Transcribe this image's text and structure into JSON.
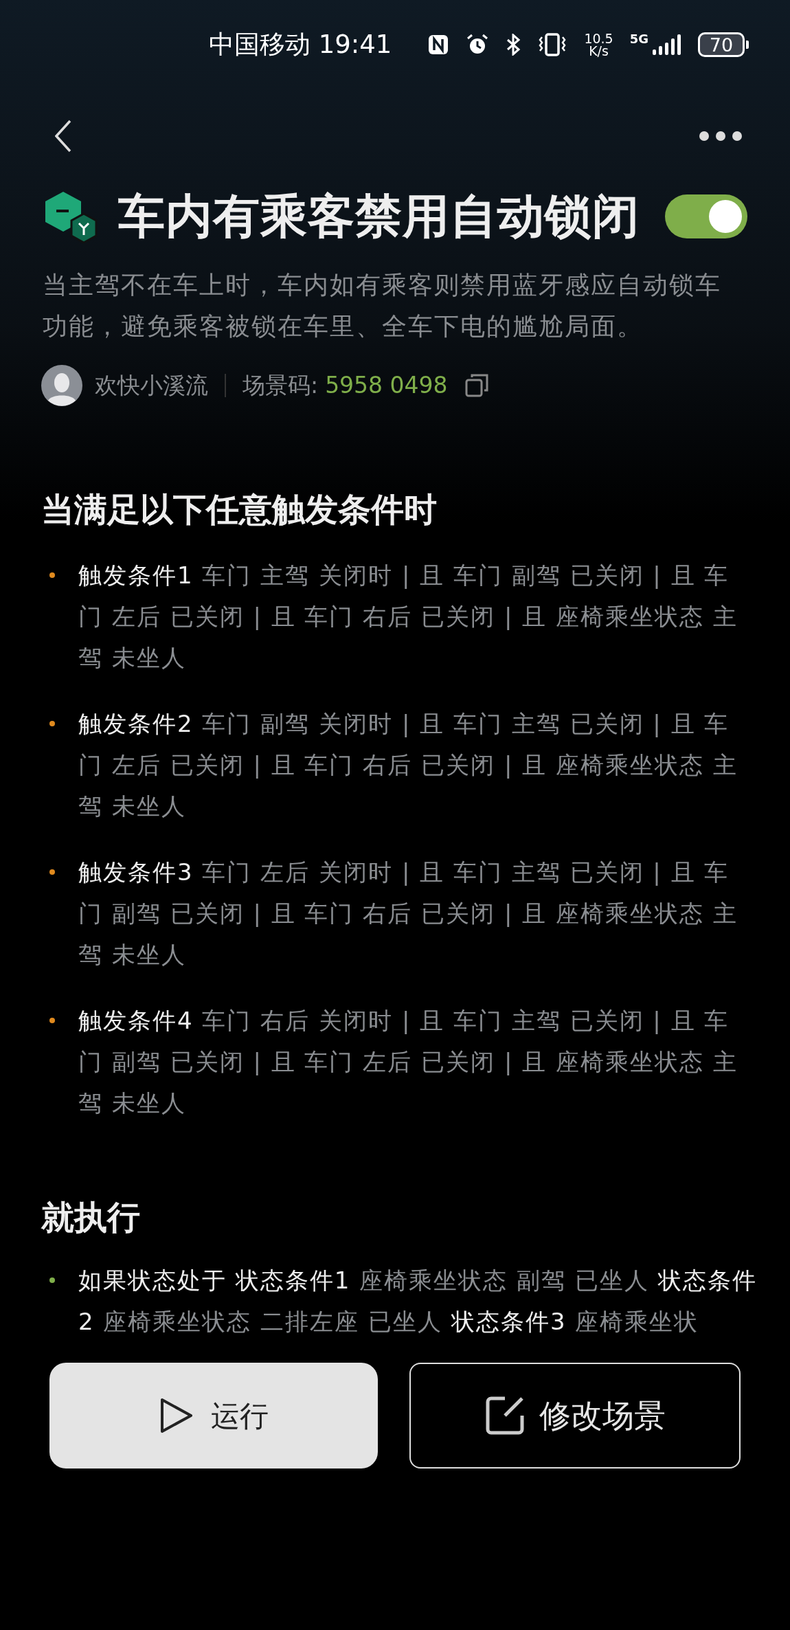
{
  "status_bar": {
    "carrier": "中国移动",
    "time": "19:41",
    "net_speed": "10.5",
    "net_unit": "K/s",
    "network": "5G",
    "battery": "70"
  },
  "scene": {
    "title": "车内有乘客禁用自动锁闭",
    "enabled": true,
    "description": "当主驾不在车上时，车内如有乘客则禁用蓝牙感应自动锁车功能，避免乘客被锁在车里、全车下电的尴尬局面。",
    "author": "欢快小溪流",
    "code_label": "场景码:",
    "code": "5958 0498"
  },
  "triggers": {
    "title": "当满足以下任意触发条件时",
    "items": [
      {
        "color": "#e08a1e",
        "label": "触发条件1",
        "detail": "车门 主驾 关闭时 | 且 车门 副驾 已关闭 | 且 车门 左后 已关闭 | 且 车门 右后 已关闭 | 且 座椅乘坐状态 主驾 未坐人"
      },
      {
        "color": "#e08a1e",
        "label": "触发条件2",
        "detail": "车门 副驾 关闭时 | 且 车门 主驾 已关闭 | 且 车门 左后 已关闭 | 且 车门 右后 已关闭 | 且 座椅乘坐状态 主驾 未坐人"
      },
      {
        "color": "#e08a1e",
        "label": "触发条件3",
        "detail": "车门 左后 关闭时 | 且 车门 主驾 已关闭 | 且 车门 副驾 已关闭 | 且 车门 右后 已关闭 | 且 座椅乘坐状态 主驾 未坐人"
      },
      {
        "color": "#e08a1e",
        "label": "触发条件4",
        "detail": "车门 右后 关闭时 | 且 车门 主驾 已关闭 | 且 车门 副驾 已关闭 | 且 车门 左后 已关闭 | 且 座椅乘坐状态 主驾 未坐人"
      }
    ]
  },
  "actions": {
    "title": "就执行",
    "items": [
      {
        "color": "#7fae4a",
        "segments": [
          {
            "kind": "label",
            "text": "如果状态处于"
          },
          {
            "kind": "label",
            "text": "状态条件1"
          },
          {
            "kind": "detail",
            "text": "座椅乘坐状态 副驾 已坐人"
          },
          {
            "kind": "label",
            "text": "状态条件2"
          },
          {
            "kind": "detail",
            "text": "座椅乘坐状态 二排左座 已坐人"
          },
          {
            "kind": "label",
            "text": "状态条件3"
          },
          {
            "kind": "detail",
            "text": "座椅乘坐状"
          }
        ]
      }
    ]
  },
  "buttons": [
    {
      "kind": "run",
      "label": "运行"
    },
    {
      "kind": "edit",
      "label": "修改场景"
    }
  ]
}
